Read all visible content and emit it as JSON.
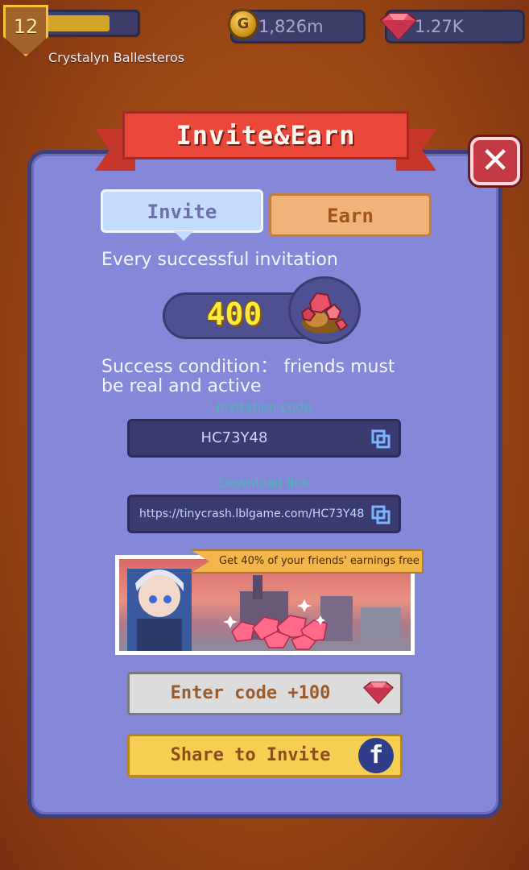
{
  "hud": {
    "level": "12",
    "xp_progress": 0.72,
    "player_name": "Crystalyn Ballesteros",
    "gold": {
      "icon": "gold-coin-icon",
      "coin_letter": "G",
      "value": "1,826m"
    },
    "gems": {
      "icon": "gem-icon",
      "value": "1.27K"
    }
  },
  "dialog": {
    "title": "Invite&Earn",
    "close_symbol": "✕",
    "tabs": [
      {
        "label": "Invite",
        "active": true
      },
      {
        "label": "Earn",
        "active": false
      }
    ],
    "reward_caption": "Every successful invitation",
    "reward_amount": "400",
    "reward_icon": "gem-pile-icon",
    "condition_line1": "Success condition： friends must",
    "condition_line2": "be real and active",
    "invitation_code_label": "Invitation code",
    "invitation_code": "HC73Y48",
    "download_link_label": "Download link",
    "download_link": "https://tinycrash.lblgame.com/HC73Y48",
    "promo_text": "Get 40% of your friends' earnings free",
    "enter_code_label": "Enter code  +100",
    "share_label": "Share to Invite",
    "share_icon": "facebook-icon"
  },
  "colors": {
    "panel": "#8587d9",
    "banner": "#e8473a",
    "gold_bar": "#d2a52a",
    "gem": "#e8536a",
    "share_button": "#f5cf52"
  }
}
